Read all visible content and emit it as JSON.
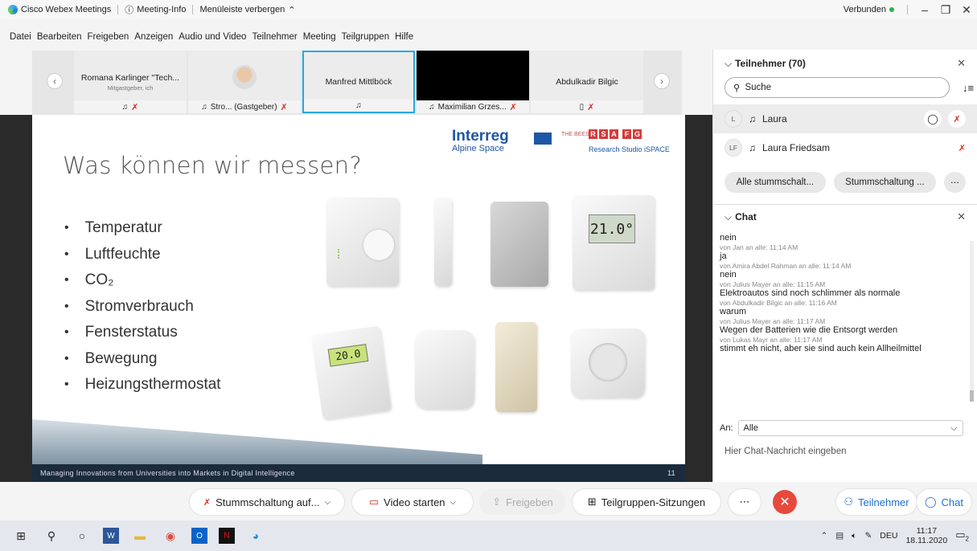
{
  "titlebar": {
    "app_name": "Cisco Webex Meetings",
    "meeting_info": "Meeting-Info",
    "hide_menu": "Menüleiste verbergen",
    "status": "Verbunden"
  },
  "menu": [
    "Datei",
    "Bearbeiten",
    "Freigeben",
    "Anzeigen",
    "Audio und Video",
    "Teilnehmer",
    "Meeting",
    "Teilgruppen",
    "Hilfe"
  ],
  "strip": {
    "tiles": [
      {
        "name": "Romana Karlinger \"Tech...",
        "sub": "Mitgastgeber, ich",
        "foot": ""
      },
      {
        "name": "",
        "sub": "",
        "foot": "Stro... (Gastgeber)"
      },
      {
        "name": "Manfred Mittlböck",
        "sub": "",
        "foot": ""
      },
      {
        "name": "",
        "sub": "",
        "foot": "Maximilian Grzes..."
      },
      {
        "name": "Abdulkadir Bilgic",
        "sub": "",
        "foot": ""
      }
    ]
  },
  "slide": {
    "title": "Was können wir messen?",
    "bullets": [
      "Temperatur",
      "Luftfeuchte",
      "CO₂",
      "Stromverbrauch",
      "Fensterstatus",
      "Bewegung",
      "Heizungsthermostat"
    ],
    "logo_interreg": "Interreg",
    "logo_alpine": "Alpine Space",
    "logo_bees": "THE BEES",
    "logo_rsa": [
      "R",
      "S",
      "A",
      "F",
      "G"
    ],
    "logo_rs": "Research Studio iSPACE",
    "footer": "Managing Innovations from Universities into Markets in Digital Intelligence",
    "page": "11",
    "display_temp": "21.0°",
    "thermo_temp": "20.0"
  },
  "participants_panel": {
    "title": "Teilnehmer (70)",
    "search_placeholder": "Suche",
    "people": [
      {
        "initials": "L",
        "name": "Laura"
      },
      {
        "initials": "LF",
        "name": "Laura Friedsam"
      }
    ],
    "mute_all": "Alle stummschalt...",
    "mute": "Stummschaltung ..."
  },
  "chat": {
    "title": "Chat",
    "messages": [
      {
        "text": "nein",
        "meta": "von Jan an alle:   11:14 AM"
      },
      {
        "text": "ja",
        "meta": "von Amira Abdel Rahman  an alle:   11:14 AM"
      },
      {
        "text": "nein",
        "meta": "von Julius Mayer an alle:   11:15 AM"
      },
      {
        "text": "Elektroautos sind noch schlimmer als normale",
        "meta": "von Abdulkadir Bilgic an alle:   11:16 AM"
      },
      {
        "text": "warum",
        "meta": "von Julius Mayer an alle:   11:17 AM"
      },
      {
        "text": "Wegen der Batterien wie die Entsorgt werden",
        "meta": "von Lukas Mayr an alle:   11:17 AM"
      },
      {
        "text": "stimmt eh nicht, aber sie sind auch kein Allheilmittel",
        "meta": ""
      }
    ],
    "to_label": "An:",
    "to_value": "Alle",
    "input_placeholder": "Hier Chat-Nachricht eingeben"
  },
  "controls": {
    "mute": "Stummschaltung auf...",
    "video": "Video starten",
    "share": "Freigeben",
    "breakout": "Teilgruppen-Sitzungen",
    "participants": "Teilnehmer",
    "chat": "Chat"
  },
  "taskbar": {
    "lang": "DEU",
    "time": "11:17",
    "date": "18.11.2020",
    "notifications": "2"
  }
}
